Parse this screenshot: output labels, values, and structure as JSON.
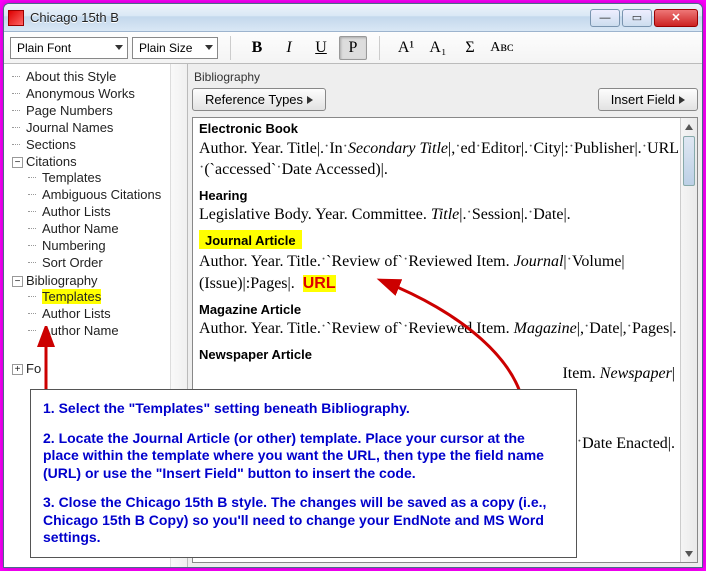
{
  "window": {
    "title": "Chicago 15th B"
  },
  "toolbar": {
    "font_combo": "Plain Font",
    "size_combo": "Plain Size",
    "bold": "B",
    "italic": "I",
    "underline": "U",
    "plain": "P",
    "sup": "A¹",
    "sub": "A₁",
    "sigma": "Σ",
    "smallcaps": "Aʙᴄ"
  },
  "tree": {
    "about": "About this Style",
    "anon": "Anonymous Works",
    "pagenums": "Page Numbers",
    "journalnames": "Journal Names",
    "sections": "Sections",
    "citations": "Citations",
    "cit_children": {
      "templates": "Templates",
      "ambiguous": "Ambiguous Citations",
      "authorlists": "Author Lists",
      "authorname": "Author Name",
      "numbering": "Numbering",
      "sortorder": "Sort Order"
    },
    "bibliography": "Bibliography",
    "bib_children": {
      "templates": "Templates",
      "authorlists": "Author Lists",
      "authorname": "Author Name"
    },
    "fo": "Fo"
  },
  "right": {
    "panel_label": "Bibliography",
    "reftypes_btn": "Reference Types",
    "insertfield_btn": "Insert Field"
  },
  "templates": {
    "ebook": {
      "head": "Electronic Book",
      "body": "Author. Year. Title|.·In·Secondary Title|,·ed·Editor|.·City|:·Publisher|.·URL|·(`accessed`·Date Accessed)|."
    },
    "hearing": {
      "head": "Hearing",
      "body": "Legislative Body. Year. Committee. Title|.·Session|.·Date|."
    },
    "journal": {
      "head": "Journal Article",
      "body_pre": "Author. Year. Title.·`Review of`·Reviewed Item. Journal|·Volume| (Issue)|:Pages|.  ",
      "url_label": "URL"
    },
    "magazine": {
      "head": "Magazine Article",
      "body": "Author. Year. Title.·`Review of`·Reviewed Item. Magazine|,·Date|,·Pages|."
    },
    "newspaper": {
      "head": "Newspaper Article",
      "body_tail": "Item. Newspaper|"
    },
    "enacted": {
      "body_tail": "·Date Enacted|."
    }
  },
  "overlay": {
    "p1": "1. Select the \"Templates\" setting beneath Bibliography.",
    "p2": "2. Locate the Journal Article (or other) template. Place your cursor at the place within the template where you want the URL, then type the field name (URL) or use the \"Insert Field\" button to insert the code.",
    "p3": "3. Close the Chicago 15th B style. The changes will be saved as a copy (i.e., Chicago 15th B Copy) so you'll need to change your EndNote and MS Word settings."
  }
}
